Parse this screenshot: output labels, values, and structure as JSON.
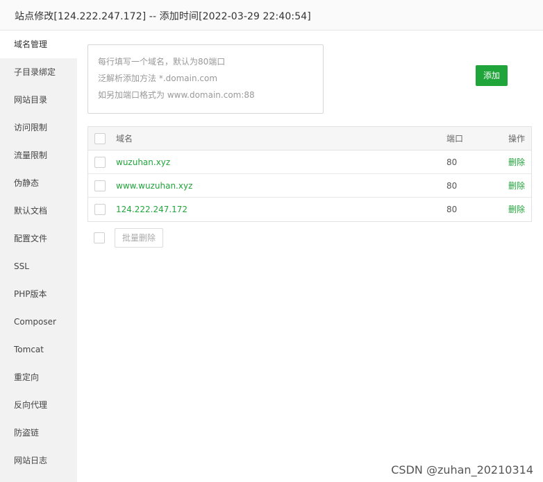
{
  "window": {
    "title": "站点修改[124.222.247.172] -- 添加时间[2022-03-29 22:40:54]"
  },
  "sidebar": {
    "items": [
      {
        "label": "域名管理",
        "active": true
      },
      {
        "label": "子目录绑定"
      },
      {
        "label": "网站目录"
      },
      {
        "label": "访问限制"
      },
      {
        "label": "流量限制"
      },
      {
        "label": "伪静态"
      },
      {
        "label": "默认文档"
      },
      {
        "label": "配置文件"
      },
      {
        "label": "SSL"
      },
      {
        "label": "PHP版本"
      },
      {
        "label": "Composer"
      },
      {
        "label": "Tomcat"
      },
      {
        "label": "重定向"
      },
      {
        "label": "反向代理"
      },
      {
        "label": "防盗链"
      },
      {
        "label": "网站日志"
      }
    ]
  },
  "domain_input": {
    "placeholder_lines": [
      "每行填写一个域名，默认为80端口",
      "泛解析添加方法 *.domain.com",
      "如另加端口格式为 www.domain.com:88"
    ]
  },
  "add_button": {
    "label": "添加"
  },
  "table": {
    "headers": {
      "domain": "域名",
      "port": "端口",
      "action": "操作"
    },
    "rows": [
      {
        "domain": "wuzuhan.xyz",
        "port": "80",
        "action": "删除"
      },
      {
        "domain": "www.wuzuhan.xyz",
        "port": "80",
        "action": "删除"
      },
      {
        "domain": "124.222.247.172",
        "port": "80",
        "action": "删除"
      }
    ]
  },
  "bulk": {
    "delete_label": "批量删除"
  },
  "watermark": "CSDN @zuhan_20210314",
  "colors": {
    "accent": "#20a53a",
    "sidebar_bg": "#f2f2f2"
  }
}
